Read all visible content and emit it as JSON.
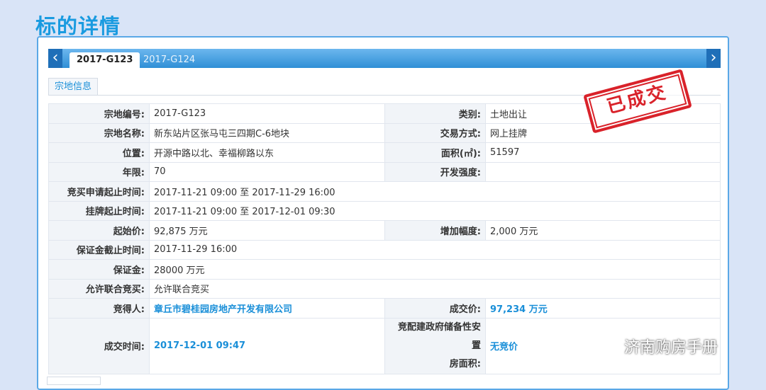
{
  "page": {
    "title": "标的详情"
  },
  "tabs": {
    "active": "2017-G123",
    "inactive": "2017-G124",
    "prev_arrow": "‹",
    "next_arrow": "›"
  },
  "subtab": {
    "label": "宗地信息"
  },
  "stamp": {
    "text": "已成交",
    "color": "#d9222a"
  },
  "watermark": {
    "text": "济南购房手册",
    "icon": "wechat-icon"
  },
  "rows": {
    "r1": {
      "l1": "宗地编号:",
      "v1": "2017-G123",
      "l2": "类别:",
      "v2": "土地出让"
    },
    "r2": {
      "l1": "宗地名称:",
      "v1": "新东站片区张马屯三四期C-6地块",
      "l2": "交易方式:",
      "v2": "网上挂牌"
    },
    "r3": {
      "l1": "位置:",
      "v1": "开源中路以北、幸福柳路以东",
      "l2": "面积(㎡):",
      "v2": "51597"
    },
    "r4": {
      "l1": "年限:",
      "v1": "70",
      "l2": "开发强度:",
      "v2": ""
    },
    "r5": {
      "l1": "竞买申请起止时间:",
      "v1": "2017-11-21 09:00 至 2017-11-29 16:00"
    },
    "r6": {
      "l1": "挂牌起止时间:",
      "v1": "2017-11-21 09:00 至 2017-12-01 09:30"
    },
    "r7": {
      "l1": "起始价:",
      "v1": "92,875 万元",
      "l2": "增加幅度:",
      "v2": "2,000 万元"
    },
    "r8": {
      "l1": "保证金截止时间:",
      "v1": "2017-11-29 16:00"
    },
    "r9": {
      "l1": "保证金:",
      "v1": "28000 万元"
    },
    "r10": {
      "l1": "允许联合竞买:",
      "v1": "允许联合竞买"
    },
    "r11": {
      "l1": "竞得人:",
      "v1": "章丘市碧桂园房地产开发有限公司",
      "l2": "成交价:",
      "v2": "97,234 万元"
    },
    "r12": {
      "l1": "成交时间:",
      "v1": "2017-12-01 09:47",
      "l2a": "竞配建政府储备性安置",
      "l2b": "房面积:",
      "v2": "无竞价"
    }
  }
}
